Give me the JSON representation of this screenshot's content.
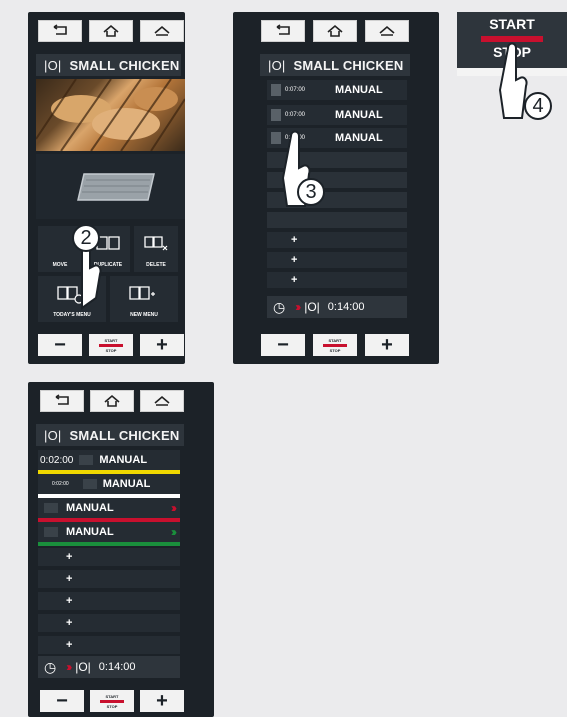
{
  "common": {
    "title": "SMALL CHICKEN",
    "minus": "−",
    "plus": "+",
    "start_label": "START",
    "stop_label": "STOP"
  },
  "panel1": {
    "buttons": [
      "MOVE",
      "DUPLICATE",
      "DELETE"
    ],
    "lower_buttons": [
      "TODAY'S MENU",
      "NEW MENU"
    ],
    "step": "2"
  },
  "panel2": {
    "rows": [
      {
        "time": "0:07:00",
        "label": "MANUAL"
      },
      {
        "time": "0:07:00",
        "label": "MANUAL"
      },
      {
        "time": "0:07:00",
        "label": "MANUAL"
      }
    ],
    "empty_rows": [
      "+",
      "+",
      "+"
    ],
    "total_time": "0:14:00",
    "step": "3"
  },
  "callout": {
    "start": "START",
    "stop": "STOP",
    "step": "4"
  },
  "panel3": {
    "rows": [
      {
        "time": "0:02:00",
        "label": "MANUAL",
        "color": "#f0d800"
      },
      {
        "time": "0:02:00",
        "label": "MANUAL",
        "color": "#ffffff"
      },
      {
        "label": "MANUAL",
        "color": "#c8102e"
      },
      {
        "label": "MANUAL",
        "color": "#1a8f3c"
      }
    ],
    "plus_rows": [
      "+",
      "+",
      "+",
      "+",
      "+"
    ],
    "total_time": "0:14:00"
  },
  "colors": {
    "panel_bg": "#1c2228",
    "accent_red": "#c8102e",
    "accent_green": "#1a8f3c",
    "accent_yellow": "#f0d800"
  }
}
